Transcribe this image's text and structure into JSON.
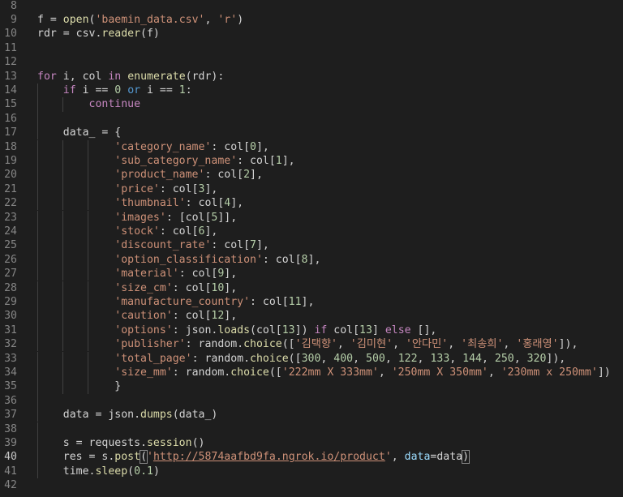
{
  "editor": {
    "active_line": "40",
    "colors": {
      "background": "#1e1e1e",
      "plain": "#d4d4d4",
      "keyword_control": "#c586c0",
      "keyword": "#569cd6",
      "function": "#dcdcaa",
      "string": "#ce9178",
      "number": "#b5cea8",
      "parameter": "#9cdcfe",
      "line_number": "#858585"
    },
    "lines": [
      {
        "num": "8",
        "indent": 0,
        "tokens": []
      },
      {
        "num": "9",
        "indent": 0,
        "tokens": [
          {
            "t": "plain",
            "v": "f = "
          },
          {
            "t": "fn",
            "v": "open"
          },
          {
            "t": "plain",
            "v": "("
          },
          {
            "t": "str",
            "v": "'baemin_data.csv'"
          },
          {
            "t": "plain",
            "v": ", "
          },
          {
            "t": "str",
            "v": "'r'"
          },
          {
            "t": "plain",
            "v": ")"
          }
        ]
      },
      {
        "num": "10",
        "indent": 0,
        "tokens": [
          {
            "t": "plain",
            "v": "rdr = csv."
          },
          {
            "t": "fn",
            "v": "reader"
          },
          {
            "t": "plain",
            "v": "(f)"
          }
        ]
      },
      {
        "num": "11",
        "indent": 0,
        "tokens": []
      },
      {
        "num": "12",
        "indent": 0,
        "tokens": []
      },
      {
        "num": "13",
        "indent": 0,
        "tokens": [
          {
            "t": "kw",
            "v": "for"
          },
          {
            "t": "plain",
            "v": " i, col "
          },
          {
            "t": "kw",
            "v": "in"
          },
          {
            "t": "plain",
            "v": " "
          },
          {
            "t": "fn",
            "v": "enumerate"
          },
          {
            "t": "plain",
            "v": "(rdr):"
          }
        ]
      },
      {
        "num": "14",
        "indent": 1,
        "tokens": [
          {
            "t": "kw",
            "v": "if"
          },
          {
            "t": "plain",
            "v": " i == "
          },
          {
            "t": "num",
            "v": "0"
          },
          {
            "t": "plain",
            "v": " "
          },
          {
            "t": "bkw",
            "v": "or"
          },
          {
            "t": "plain",
            "v": " i == "
          },
          {
            "t": "num",
            "v": "1"
          },
          {
            "t": "plain",
            "v": ":"
          }
        ]
      },
      {
        "num": "15",
        "indent": 2,
        "tokens": [
          {
            "t": "kw",
            "v": "continue"
          }
        ]
      },
      {
        "num": "16",
        "indent": 1,
        "tokens": []
      },
      {
        "num": "17",
        "indent": 1,
        "tokens": [
          {
            "t": "plain",
            "v": "data_ = {"
          }
        ]
      },
      {
        "num": "18",
        "indent": 3,
        "tokens": [
          {
            "t": "str",
            "v": "'category_name'"
          },
          {
            "t": "plain",
            "v": ": col["
          },
          {
            "t": "num",
            "v": "0"
          },
          {
            "t": "plain",
            "v": "],"
          }
        ]
      },
      {
        "num": "19",
        "indent": 3,
        "tokens": [
          {
            "t": "str",
            "v": "'sub_category_name'"
          },
          {
            "t": "plain",
            "v": ": col["
          },
          {
            "t": "num",
            "v": "1"
          },
          {
            "t": "plain",
            "v": "],"
          }
        ]
      },
      {
        "num": "20",
        "indent": 3,
        "tokens": [
          {
            "t": "str",
            "v": "'product_name'"
          },
          {
            "t": "plain",
            "v": ": col["
          },
          {
            "t": "num",
            "v": "2"
          },
          {
            "t": "plain",
            "v": "],"
          }
        ]
      },
      {
        "num": "21",
        "indent": 3,
        "tokens": [
          {
            "t": "str",
            "v": "'price'"
          },
          {
            "t": "plain",
            "v": ": col["
          },
          {
            "t": "num",
            "v": "3"
          },
          {
            "t": "plain",
            "v": "],"
          }
        ]
      },
      {
        "num": "22",
        "indent": 3,
        "tokens": [
          {
            "t": "str",
            "v": "'thumbnail'"
          },
          {
            "t": "plain",
            "v": ": col["
          },
          {
            "t": "num",
            "v": "4"
          },
          {
            "t": "plain",
            "v": "],"
          }
        ]
      },
      {
        "num": "23",
        "indent": 3,
        "tokens": [
          {
            "t": "str",
            "v": "'images'"
          },
          {
            "t": "plain",
            "v": ": [col["
          },
          {
            "t": "num",
            "v": "5"
          },
          {
            "t": "plain",
            "v": "]],"
          }
        ]
      },
      {
        "num": "24",
        "indent": 3,
        "tokens": [
          {
            "t": "str",
            "v": "'stock'"
          },
          {
            "t": "plain",
            "v": ": col["
          },
          {
            "t": "num",
            "v": "6"
          },
          {
            "t": "plain",
            "v": "],"
          }
        ]
      },
      {
        "num": "25",
        "indent": 3,
        "tokens": [
          {
            "t": "str",
            "v": "'discount_rate'"
          },
          {
            "t": "plain",
            "v": ": col["
          },
          {
            "t": "num",
            "v": "7"
          },
          {
            "t": "plain",
            "v": "],"
          }
        ]
      },
      {
        "num": "26",
        "indent": 3,
        "tokens": [
          {
            "t": "str",
            "v": "'option_classification'"
          },
          {
            "t": "plain",
            "v": ": col["
          },
          {
            "t": "num",
            "v": "8"
          },
          {
            "t": "plain",
            "v": "],"
          }
        ]
      },
      {
        "num": "27",
        "indent": 3,
        "tokens": [
          {
            "t": "str",
            "v": "'material'"
          },
          {
            "t": "plain",
            "v": ": col["
          },
          {
            "t": "num",
            "v": "9"
          },
          {
            "t": "plain",
            "v": "],"
          }
        ]
      },
      {
        "num": "28",
        "indent": 3,
        "tokens": [
          {
            "t": "str",
            "v": "'size_cm'"
          },
          {
            "t": "plain",
            "v": ": col["
          },
          {
            "t": "num",
            "v": "10"
          },
          {
            "t": "plain",
            "v": "],"
          }
        ]
      },
      {
        "num": "29",
        "indent": 3,
        "tokens": [
          {
            "t": "str",
            "v": "'manufacture_country'"
          },
          {
            "t": "plain",
            "v": ": col["
          },
          {
            "t": "num",
            "v": "11"
          },
          {
            "t": "plain",
            "v": "],"
          }
        ]
      },
      {
        "num": "30",
        "indent": 3,
        "tokens": [
          {
            "t": "str",
            "v": "'caution'"
          },
          {
            "t": "plain",
            "v": ": col["
          },
          {
            "t": "num",
            "v": "12"
          },
          {
            "t": "plain",
            "v": "],"
          }
        ]
      },
      {
        "num": "31",
        "indent": 3,
        "tokens": [
          {
            "t": "str",
            "v": "'options'"
          },
          {
            "t": "plain",
            "v": ": json."
          },
          {
            "t": "fn",
            "v": "loads"
          },
          {
            "t": "plain",
            "v": "(col["
          },
          {
            "t": "num",
            "v": "13"
          },
          {
            "t": "plain",
            "v": "]) "
          },
          {
            "t": "kw",
            "v": "if"
          },
          {
            "t": "plain",
            "v": " col["
          },
          {
            "t": "num",
            "v": "13"
          },
          {
            "t": "plain",
            "v": "] "
          },
          {
            "t": "kw",
            "v": "else"
          },
          {
            "t": "plain",
            "v": " [],"
          }
        ]
      },
      {
        "num": "32",
        "indent": 3,
        "tokens": [
          {
            "t": "str",
            "v": "'publisher'"
          },
          {
            "t": "plain",
            "v": ": random."
          },
          {
            "t": "fn",
            "v": "choice"
          },
          {
            "t": "plain",
            "v": "(["
          },
          {
            "t": "str",
            "v": "'김택향'"
          },
          {
            "t": "plain",
            "v": ", "
          },
          {
            "t": "str",
            "v": "'김미현'"
          },
          {
            "t": "plain",
            "v": ", "
          },
          {
            "t": "str",
            "v": "'안다민'"
          },
          {
            "t": "plain",
            "v": ", "
          },
          {
            "t": "str",
            "v": "'최송희'"
          },
          {
            "t": "plain",
            "v": ", "
          },
          {
            "t": "str",
            "v": "'홍래영'"
          },
          {
            "t": "plain",
            "v": "]),"
          }
        ]
      },
      {
        "num": "33",
        "indent": 3,
        "tokens": [
          {
            "t": "str",
            "v": "'total_page'"
          },
          {
            "t": "plain",
            "v": ": random."
          },
          {
            "t": "fn",
            "v": "choice"
          },
          {
            "t": "plain",
            "v": "(["
          },
          {
            "t": "num",
            "v": "300"
          },
          {
            "t": "plain",
            "v": ", "
          },
          {
            "t": "num",
            "v": "400"
          },
          {
            "t": "plain",
            "v": ", "
          },
          {
            "t": "num",
            "v": "500"
          },
          {
            "t": "plain",
            "v": ", "
          },
          {
            "t": "num",
            "v": "122"
          },
          {
            "t": "plain",
            "v": ", "
          },
          {
            "t": "num",
            "v": "133"
          },
          {
            "t": "plain",
            "v": ", "
          },
          {
            "t": "num",
            "v": "144"
          },
          {
            "t": "plain",
            "v": ", "
          },
          {
            "t": "num",
            "v": "250"
          },
          {
            "t": "plain",
            "v": ", "
          },
          {
            "t": "num",
            "v": "320"
          },
          {
            "t": "plain",
            "v": "]),"
          }
        ]
      },
      {
        "num": "34",
        "indent": 3,
        "tokens": [
          {
            "t": "str",
            "v": "'size_mm'"
          },
          {
            "t": "plain",
            "v": ": random."
          },
          {
            "t": "fn",
            "v": "choice"
          },
          {
            "t": "plain",
            "v": "(["
          },
          {
            "t": "str",
            "v": "'222mm X 333mm'"
          },
          {
            "t": "plain",
            "v": ", "
          },
          {
            "t": "str",
            "v": "'250mm X 350mm'"
          },
          {
            "t": "plain",
            "v": ", "
          },
          {
            "t": "str",
            "v": "'230mm x 250mm'"
          },
          {
            "t": "plain",
            "v": "])"
          }
        ]
      },
      {
        "num": "35",
        "indent": 3,
        "tokens": [
          {
            "t": "plain",
            "v": "}"
          }
        ]
      },
      {
        "num": "36",
        "indent": 1,
        "tokens": []
      },
      {
        "num": "37",
        "indent": 1,
        "tokens": [
          {
            "t": "plain",
            "v": "data = json."
          },
          {
            "t": "fn",
            "v": "dumps"
          },
          {
            "t": "plain",
            "v": "(data_)"
          }
        ]
      },
      {
        "num": "38",
        "indent": 1,
        "tokens": []
      },
      {
        "num": "39",
        "indent": 1,
        "tokens": [
          {
            "t": "plain",
            "v": "s = requests."
          },
          {
            "t": "fn",
            "v": "session"
          },
          {
            "t": "plain",
            "v": "()"
          }
        ]
      },
      {
        "num": "40",
        "indent": 1,
        "tokens": [
          {
            "t": "plain",
            "v": "res = s."
          },
          {
            "t": "fn",
            "v": "post"
          },
          {
            "t": "box",
            "v": "("
          },
          {
            "t": "str",
            "v": "'"
          },
          {
            "t": "url",
            "v": "http://5874aafbd9fa.ngrok.io/product"
          },
          {
            "t": "str",
            "v": "'"
          },
          {
            "t": "plain",
            "v": ", "
          },
          {
            "t": "param",
            "v": "data"
          },
          {
            "t": "plain",
            "v": "=data"
          },
          {
            "t": "box",
            "v": ")"
          }
        ]
      },
      {
        "num": "41",
        "indent": 1,
        "tokens": [
          {
            "t": "plain",
            "v": "time."
          },
          {
            "t": "fn",
            "v": "sleep"
          },
          {
            "t": "plain",
            "v": "("
          },
          {
            "t": "num",
            "v": "0.1"
          },
          {
            "t": "plain",
            "v": ")"
          }
        ]
      },
      {
        "num": "42",
        "indent": 0,
        "tokens": []
      }
    ]
  }
}
